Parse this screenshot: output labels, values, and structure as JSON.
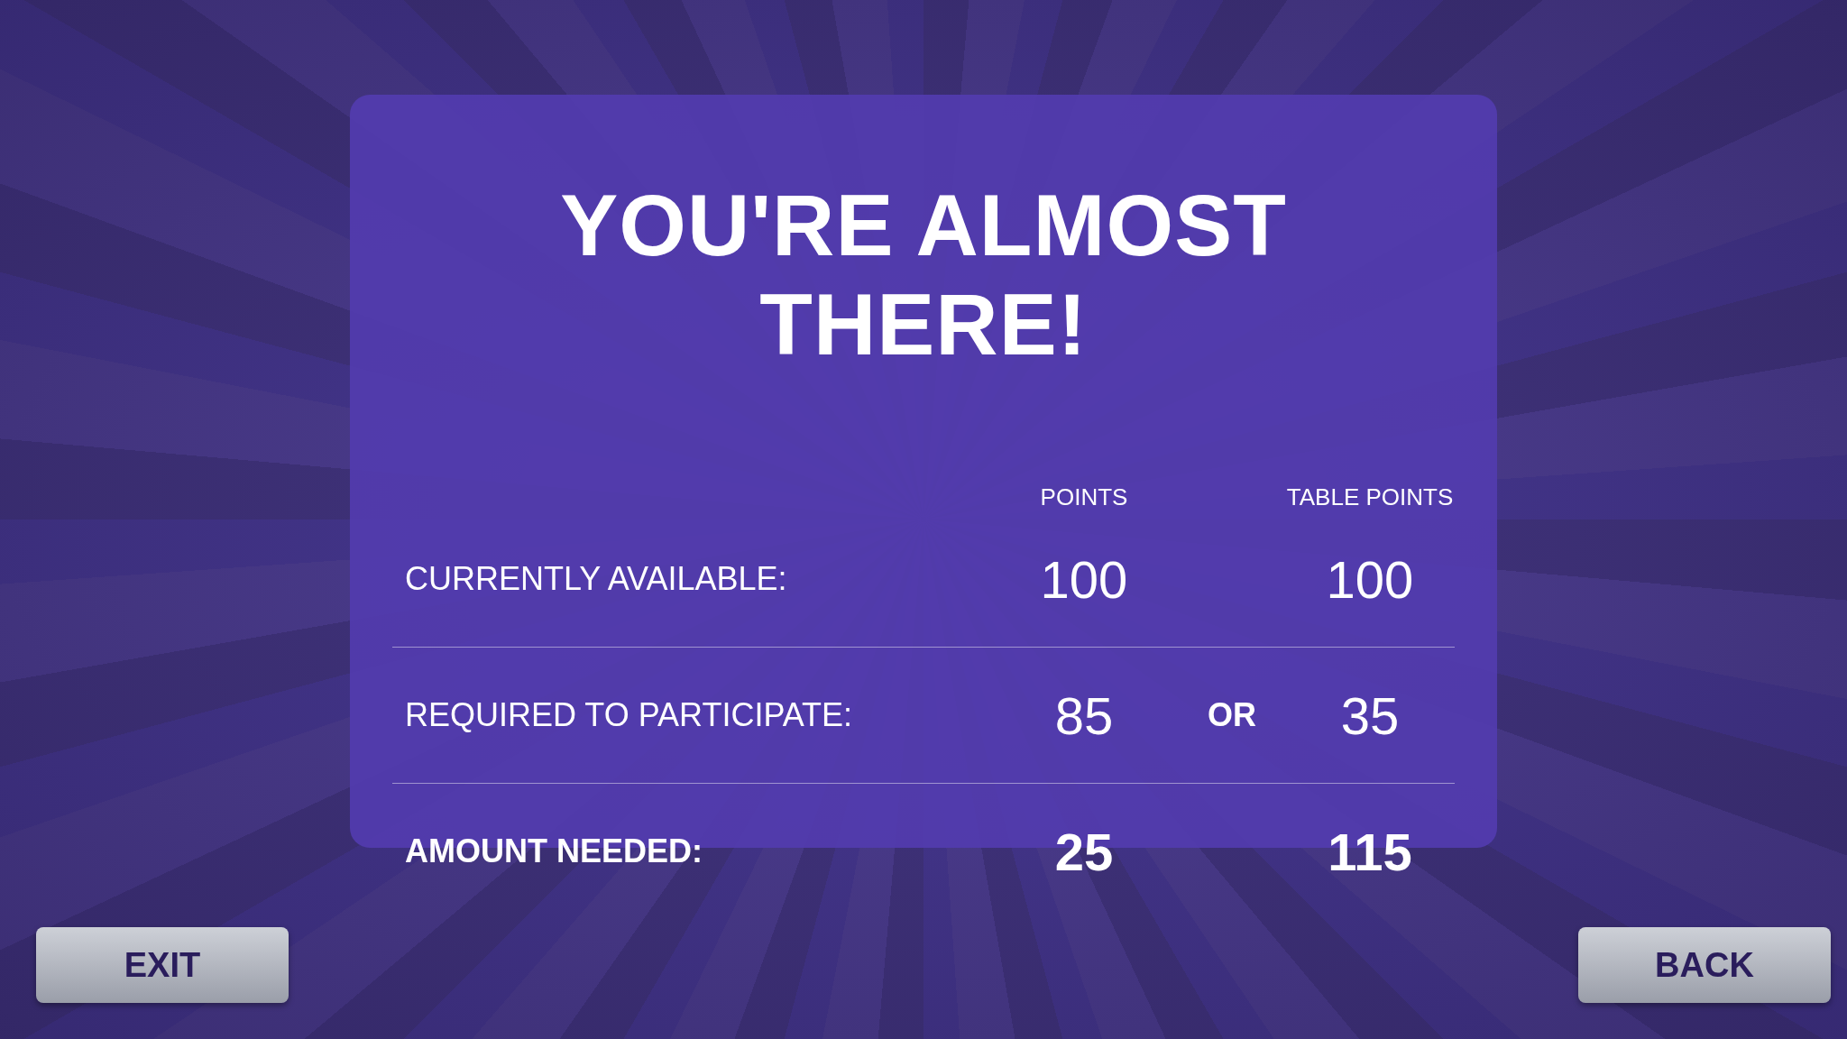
{
  "title": "YOU'RE ALMOST THERE!",
  "columns": [
    "POINTS",
    "TABLE POINTS"
  ],
  "rows": [
    {
      "kind": "normal",
      "label": "CURRENTLY AVAILABLE:",
      "points": "100",
      "table_points": "100"
    },
    {
      "kind": "normal",
      "label": "REQUIRED TO PARTICIPATE:",
      "points": "85",
      "separator": "OR",
      "table_points": "35"
    },
    {
      "kind": "total",
      "label": "AMOUNT NEEDED:",
      "points": "25",
      "table_points": "115"
    }
  ],
  "buttons": [
    {
      "label": "EXIT"
    },
    {
      "label": "BACK"
    }
  ]
}
